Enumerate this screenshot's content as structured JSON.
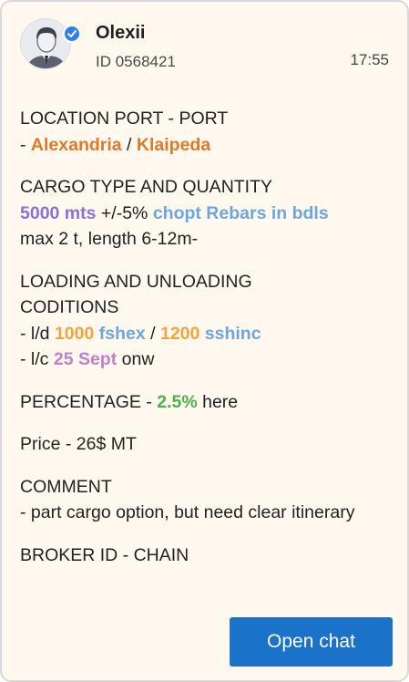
{
  "user": {
    "name": "Olexii",
    "id_label": "ID 0568421",
    "time": "17:55",
    "verified": true
  },
  "message": {
    "location": {
      "heading": "LOCATION PORT - PORT",
      "prefix": "- ",
      "from": "Alexandria",
      "sep": " / ",
      "to": "Klaipeda"
    },
    "cargo": {
      "heading": "CARGO TYPE AND QUANTITY",
      "qty": "5000 mts",
      "tolerance": " +/-5% ",
      "type": "chopt Rebars in bdls",
      "detail": "max 2 t, length 6-12m-"
    },
    "loading": {
      "heading_line1": "LOADING AND UNLOADING",
      "heading_line2": "CODITIONS",
      "ld_prefix": "- l/d ",
      "load_rate": "1000",
      "load_term": "fshex",
      "ld_sep": " / ",
      "disch_rate": "1200",
      "disch_term": "sshinc",
      "lc_prefix": "- l/c ",
      "laycan": "25 Sept",
      "lc_suffix": " onw"
    },
    "percentage": {
      "prefix": "PERCENTAGE - ",
      "value": "2.5%",
      "suffix": " here"
    },
    "price": "Price - 26$ MT",
    "comment": {
      "heading": "COMMENT",
      "text": "- part cargo option, but need clear itinerary"
    },
    "broker": "BROKER ID - CHAIN"
  },
  "actions": {
    "open_chat": "Open chat"
  },
  "colors": {
    "background": "#fef8ee",
    "port": "#e0782a",
    "quantity": "#8773d9",
    "cargo_type": "#6fa6dc",
    "rate": "#f0a43a",
    "laycan": "#c77dc9",
    "percentage": "#4cb04c",
    "button": "#1a73c9"
  }
}
